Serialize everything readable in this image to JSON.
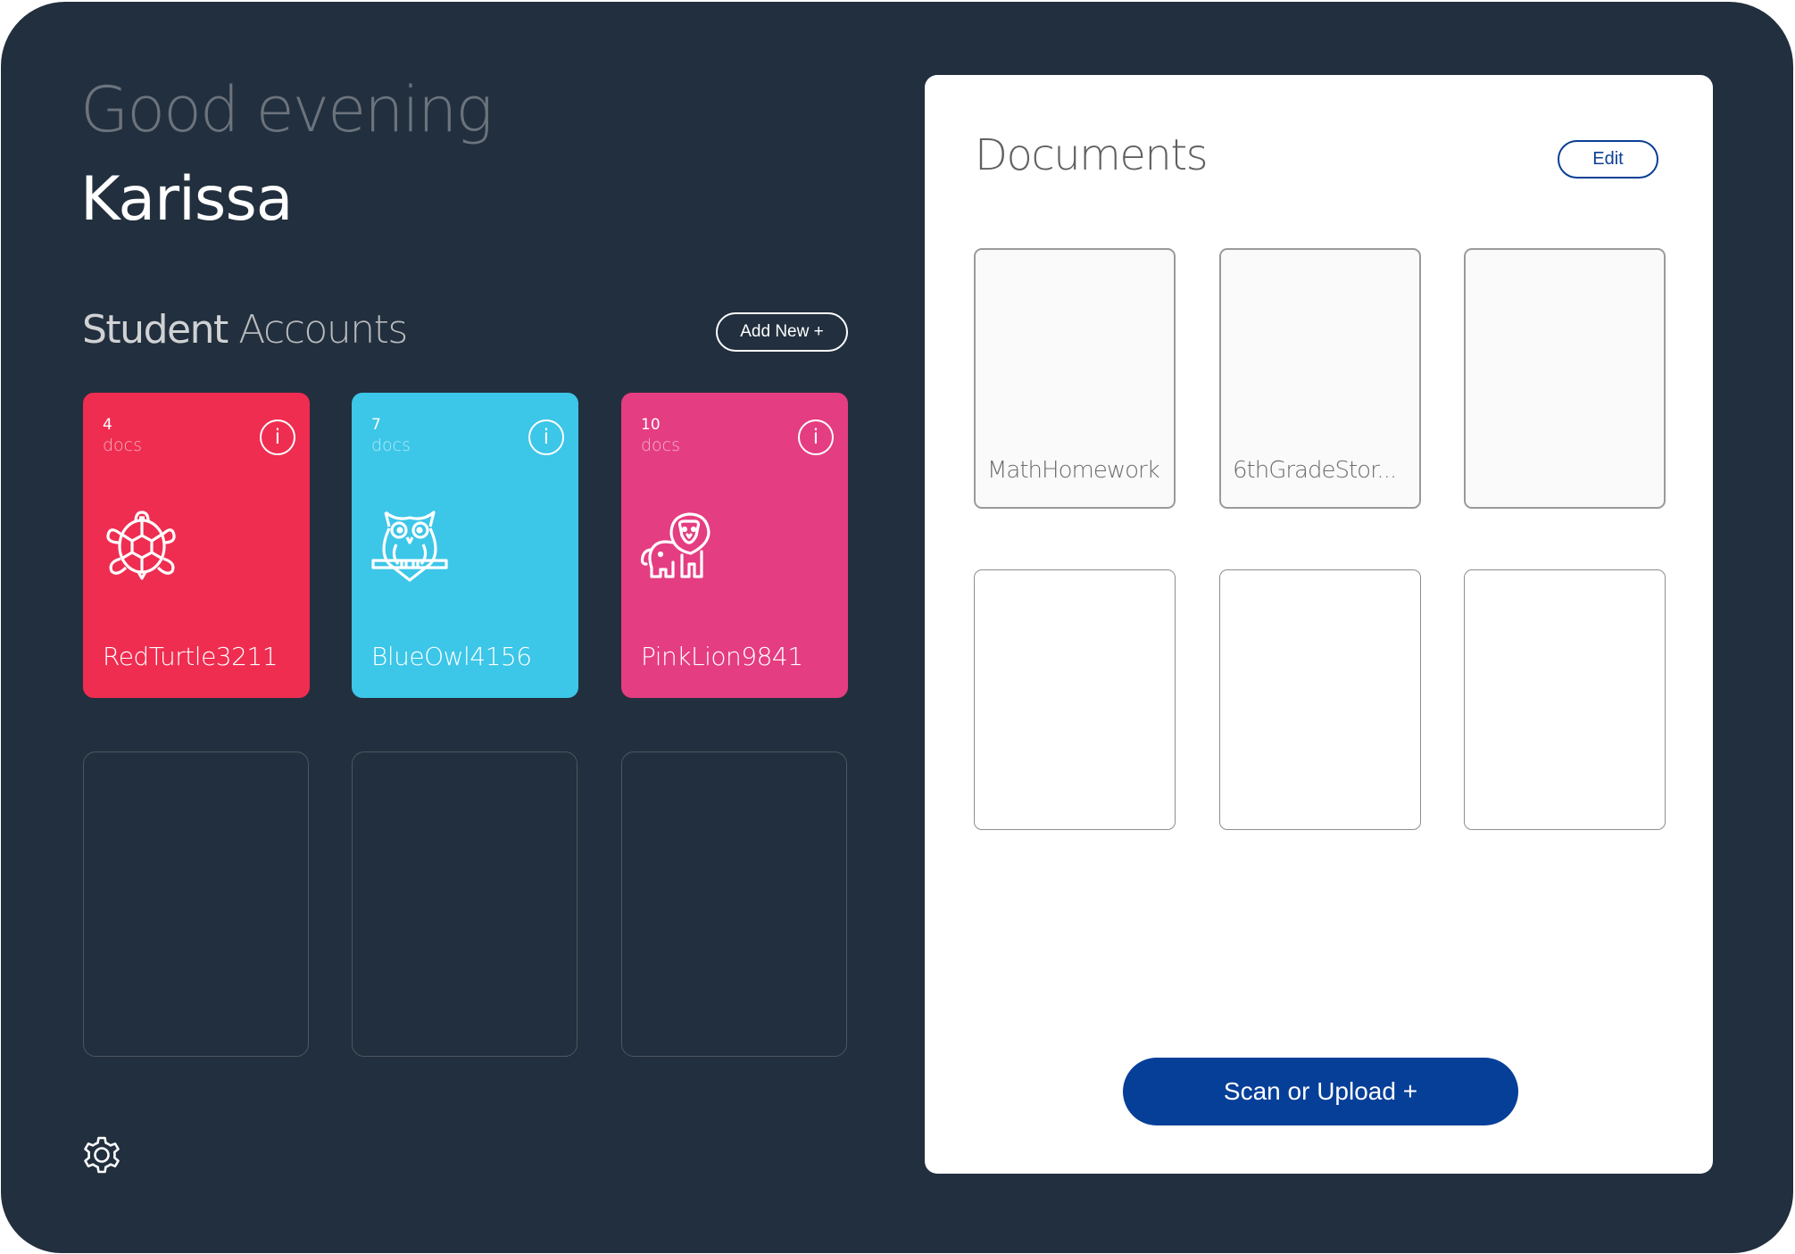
{
  "greeting": "Good evening",
  "user_name": "Karissa",
  "student_accounts": {
    "title_strong": "Student",
    "title_light": "Accounts",
    "add_button_label": "Add New +",
    "cards": [
      {
        "count": "4",
        "docs_label": "docs",
        "name": "RedTurtle3211",
        "animal": "turtle-icon",
        "color": "#ef2d50"
      },
      {
        "count": "7",
        "docs_label": "docs",
        "name": "BlueOwl4156",
        "animal": "owl-icon",
        "color": "#3cc6e8"
      },
      {
        "count": "10",
        "docs_label": "docs",
        "name": "PinkLion9841",
        "animal": "lion-icon",
        "color": "#e53d81"
      }
    ],
    "empty_slots": 3,
    "info_glyph": "i"
  },
  "documents": {
    "title": "Documents",
    "edit_label": "Edit",
    "items": [
      {
        "name": "MathHomework"
      },
      {
        "name": "6thGradeStor..."
      },
      {
        "name": ""
      },
      {
        "name": ""
      },
      {
        "name": ""
      },
      {
        "name": ""
      }
    ],
    "scan_button_label": "Scan or Upload +"
  },
  "colors": {
    "background": "#222f3e",
    "panel": "#ffffff",
    "primary_blue": "#063f98"
  }
}
